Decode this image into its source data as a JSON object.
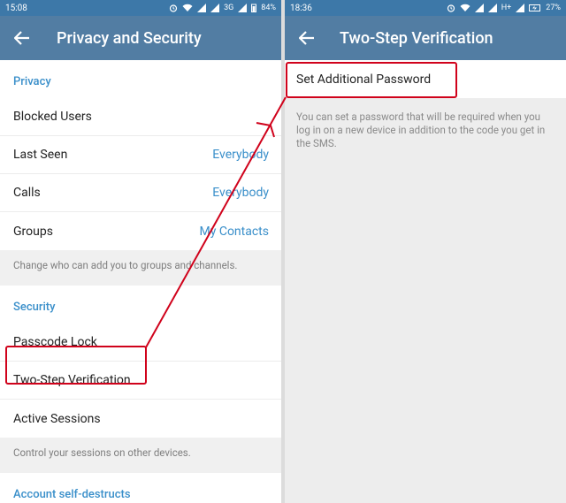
{
  "left": {
    "status": {
      "time": "15:08",
      "network": "3G",
      "battery": "84%"
    },
    "title": "Privacy and Security",
    "privacy_header": "Privacy",
    "privacy_items": [
      {
        "label": "Blocked Users",
        "value": ""
      },
      {
        "label": "Last Seen",
        "value": "Everybody"
      },
      {
        "label": "Calls",
        "value": "Everybody"
      },
      {
        "label": "Groups",
        "value": "My Contacts"
      }
    ],
    "groups_info": "Change who can add you to groups and channels.",
    "security_header": "Security",
    "security_items": [
      {
        "label": "Passcode Lock"
      },
      {
        "label": "Two-Step Verification"
      },
      {
        "label": "Active Sessions"
      }
    ],
    "sessions_info": "Control your sessions on other devices.",
    "selfdestruct_header": "Account self-destructs"
  },
  "right": {
    "status": {
      "time": "18:36",
      "network": "H+",
      "battery": "27%"
    },
    "title": "Two-Step Verification",
    "set_password": "Set Additional Password",
    "info": "You can set a password that will be required when you log in on a new device in addition to the code you get in the SMS."
  },
  "colors": {
    "appbar": "#527da3",
    "statusbar": "#3d78a8",
    "accent": "#3a8fca",
    "highlight": "#d0021b"
  }
}
